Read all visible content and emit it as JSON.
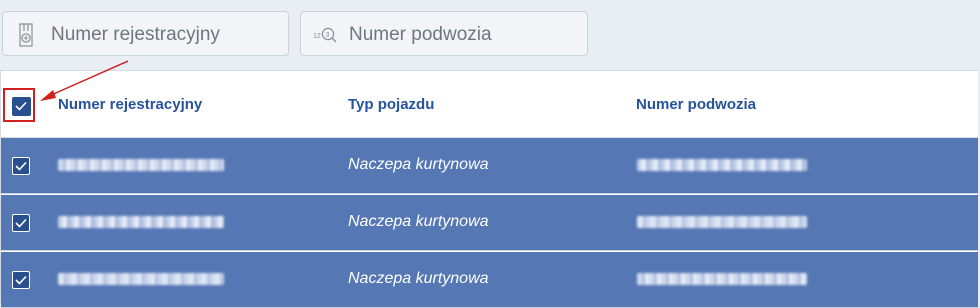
{
  "filters": {
    "registration": {
      "placeholder": "Numer rejestracyjny",
      "icon": "document-search-icon"
    },
    "chassis": {
      "placeholder": "Numer podwozia",
      "icon": "number-search-icon"
    }
  },
  "table": {
    "headers": {
      "registration": "Numer rejestracyjny",
      "vehicle_type": "Typ pojazdu",
      "chassis": "Numer podwozia"
    },
    "rows": [
      {
        "vehicle_type": "Naczepa kurtynowa"
      },
      {
        "vehicle_type": "Naczepa kurtynowa"
      },
      {
        "vehicle_type": "Naczepa kurtynowa"
      }
    ]
  },
  "colors": {
    "accent": "#27539a",
    "selected_row": "#5577b4",
    "annotation": "#d21f1f"
  }
}
